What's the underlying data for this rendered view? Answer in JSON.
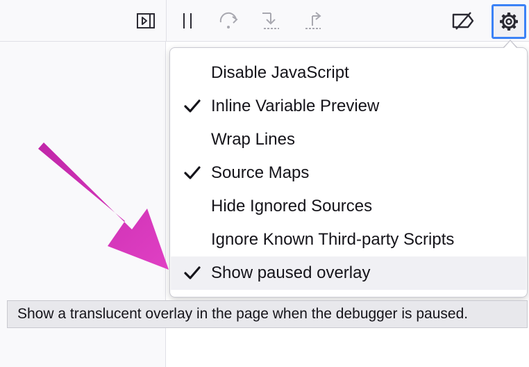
{
  "menu": {
    "items": [
      {
        "label": "Disable JavaScript",
        "checked": false,
        "highlighted": false
      },
      {
        "label": "Inline Variable Preview",
        "checked": true,
        "highlighted": false
      },
      {
        "label": "Wrap Lines",
        "checked": false,
        "highlighted": false
      },
      {
        "label": "Source Maps",
        "checked": true,
        "highlighted": false
      },
      {
        "label": "Hide Ignored Sources",
        "checked": false,
        "highlighted": false
      },
      {
        "label": "Ignore Known Third-party Scripts",
        "checked": false,
        "highlighted": false
      },
      {
        "label": "Show paused overlay",
        "checked": true,
        "highlighted": true
      }
    ]
  },
  "tooltip": {
    "text": "Show a translucent overlay in the page when the debugger is paused."
  },
  "toolbar": {
    "icons": [
      "toggle-sidebar-icon",
      "pause-icon",
      "step-over-icon",
      "step-in-icon",
      "step-out-icon",
      "disable-breakpoints-icon",
      "gear-icon"
    ]
  },
  "colors": {
    "accent": "#3b82f6",
    "annotation_arrow": "#d633b4",
    "highlight_row": "#f0f0f4"
  }
}
